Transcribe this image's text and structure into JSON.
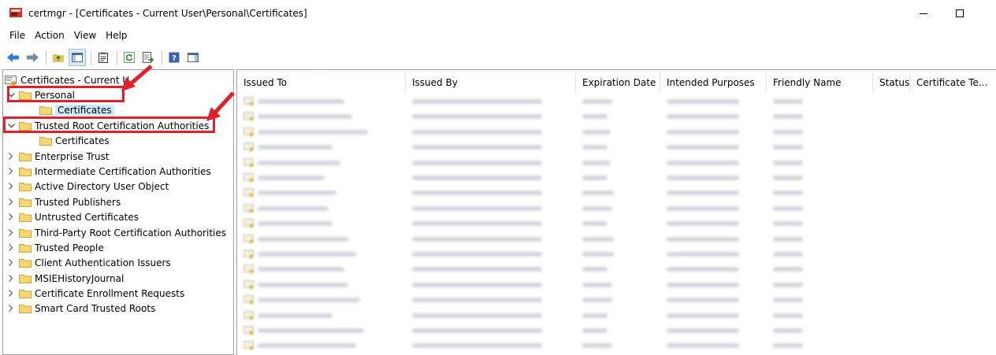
{
  "window": {
    "title": "certmgr - [Certificates - Current User\\Personal\\Certificates]"
  },
  "menu": [
    "File",
    "Action",
    "View",
    "Help"
  ],
  "toolbar_icons": [
    "back-arrow-icon",
    "forward-arrow-icon",
    "up-folder-icon",
    "show-hide-tree-icon",
    "properties-icon",
    "refresh-icon",
    "export-list-icon",
    "help-icon",
    "show-hide-action-pane-icon"
  ],
  "tree": {
    "root": "Certificates - Current U",
    "nodes": [
      {
        "label": "Personal",
        "expanded": true
      },
      {
        "label": "Certificates",
        "child": true,
        "selected": true
      },
      {
        "label": "Trusted Root Certification Authorities",
        "expanded": true
      },
      {
        "label": "Certificates",
        "child": true
      },
      {
        "label": "Enterprise Trust"
      },
      {
        "label": "Intermediate Certification Authorities"
      },
      {
        "label": "Active Directory User Object"
      },
      {
        "label": "Trusted Publishers"
      },
      {
        "label": "Untrusted Certificates"
      },
      {
        "label": "Third-Party Root Certification Authorities"
      },
      {
        "label": "Trusted People"
      },
      {
        "label": "Client Authentication Issuers"
      },
      {
        "label": "MSIEHistoryJournal"
      },
      {
        "label": "Certificate Enrollment Requests"
      },
      {
        "label": "Smart Card Trusted Roots"
      }
    ]
  },
  "table": {
    "columns": [
      "Issued To",
      "Issued By",
      "Expiration Date",
      "Intended Purposes",
      "Friendly Name",
      "Status",
      "Certificate Te..."
    ],
    "row_count_visible": 17
  },
  "colors": {
    "annotation_red": "#e0202a",
    "selection": "#cce8ff"
  }
}
